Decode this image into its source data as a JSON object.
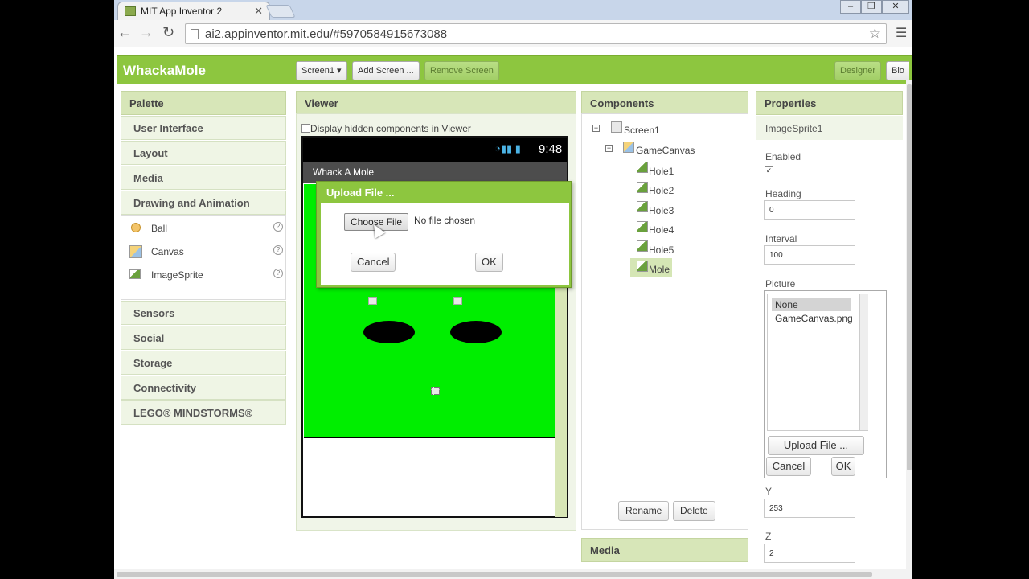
{
  "browser": {
    "tab_title": "MIT App Inventor 2",
    "url": "ai2.appinventor.mit.edu/#5970584915673088"
  },
  "appbar": {
    "brand": "WhackaMole",
    "screen_select": "Screen1 ▾",
    "add_screen": "Add Screen ...",
    "remove_screen": "Remove Screen",
    "designer": "Designer",
    "blocks": "Blo"
  },
  "palette": {
    "header": "Palette",
    "categories_top": [
      "User Interface",
      "Layout",
      "Media",
      "Drawing and Animation"
    ],
    "items": [
      {
        "label": "Ball",
        "icon": "ball-icon"
      },
      {
        "label": "Canvas",
        "icon": "canvas-icon"
      },
      {
        "label": "ImageSprite",
        "icon": "imagesprite-icon"
      }
    ],
    "categories_bottom": [
      "Sensors",
      "Social",
      "Storage",
      "Connectivity",
      "LEGO® MINDSTORMS®"
    ]
  },
  "viewer": {
    "header": "Viewer",
    "hidden_label": "Display hidden components in Viewer",
    "clock": "9:48",
    "app_title": "Whack A Mole"
  },
  "upload_dialog": {
    "title": "Upload File ...",
    "choose_file": "Choose File",
    "no_file": "No file chosen",
    "cancel": "Cancel",
    "ok": "OK"
  },
  "components": {
    "header": "Components",
    "screen": "Screen1",
    "canvas": "GameCanvas",
    "children": [
      "Hole1",
      "Hole2",
      "Hole3",
      "Hole4",
      "Hole5",
      "Mole"
    ],
    "selected": "Mole",
    "rename": "Rename",
    "delete": "Delete",
    "media_header": "Media"
  },
  "properties": {
    "header": "Properties",
    "component_name": "ImageSprite1",
    "enabled_label": "Enabled",
    "enabled_value": true,
    "heading_label": "Heading",
    "heading_value": "0",
    "interval_label": "Interval",
    "interval_value": "100",
    "picture_label": "Picture",
    "picture_options": [
      "None",
      "GameCanvas.png"
    ],
    "picture_selected": "None",
    "upload_file": "Upload File ...",
    "cancel": "Cancel",
    "ok": "OK",
    "y_label": "Y",
    "y_value": "253",
    "z_label": "Z",
    "z_value": "2"
  },
  "colors": {
    "brand_green": "#8dc63f",
    "panel_header": "#d7e6b8",
    "canvas_green": "#00ee00"
  }
}
